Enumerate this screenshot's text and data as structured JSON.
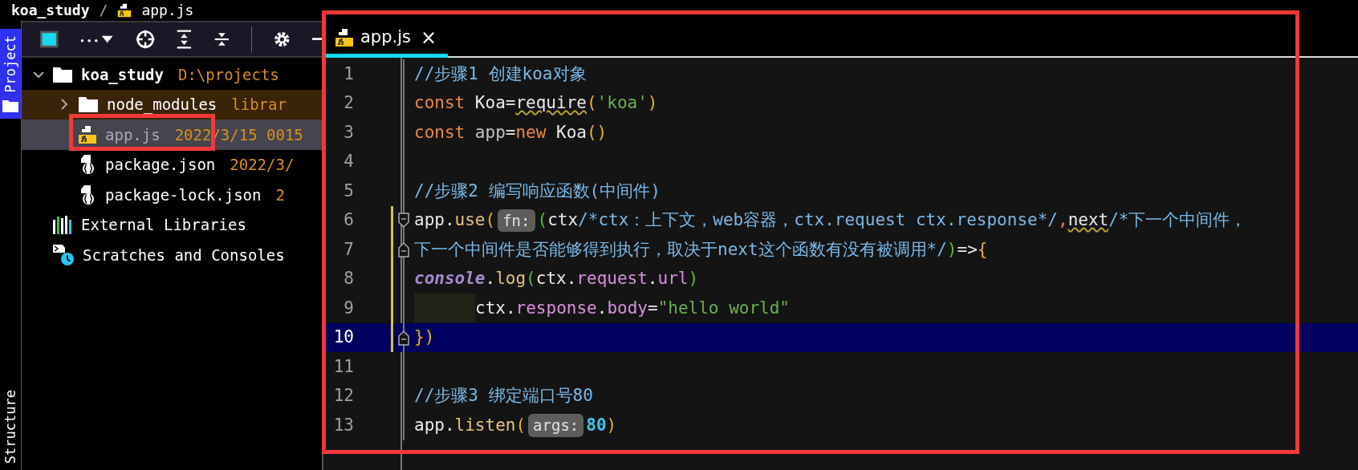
{
  "breadcrumb": [
    {
      "label": "koa_study",
      "kind": "folder"
    },
    {
      "label": "/",
      "kind": "separator"
    },
    {
      "label": "app.js",
      "kind": "js"
    }
  ],
  "side_tabs": [
    {
      "label": "Project",
      "selected": true
    },
    {
      "label": "Structure",
      "selected": false
    }
  ],
  "tree": [
    {
      "label": "koa_study",
      "detail": "D:\\projects",
      "kind": "folder",
      "bold": true,
      "expanded": true,
      "selected": false,
      "excluded": false,
      "children": [
        {
          "label": "node_modules",
          "detail": "librar",
          "kind": "folder",
          "bold": false,
          "expanded": false,
          "selected": false,
          "excluded": true
        },
        {
          "label": "app.js",
          "detail": "2022/3/15 0015",
          "kind": "js",
          "bold": false,
          "selected": true,
          "excluded": false
        },
        {
          "label": "package.json",
          "detail": "2022/3/",
          "kind": "json",
          "bold": false,
          "selected": false,
          "excluded": false
        },
        {
          "label": "package-lock.json",
          "detail": "2",
          "kind": "json",
          "bold": false,
          "selected": false,
          "excluded": false
        }
      ]
    },
    {
      "label": "External Libraries",
      "kind": "libraries",
      "bold": false,
      "selected": false,
      "excluded": false
    },
    {
      "label": "Scratches and Consoles",
      "kind": "scratches",
      "bold": false,
      "selected": false,
      "excluded": false
    }
  ],
  "tabs": [
    {
      "label": "app.js",
      "close": "×",
      "selected": true
    }
  ],
  "lines": [
    {
      "number": "1",
      "selected": false,
      "modified": false,
      "fold_open": false,
      "fold_close": false,
      "tokens": [
        {
          "kind": "comment",
          "text": "//步骤1 创建koa对象"
        }
      ]
    },
    {
      "number": "2",
      "selected": false,
      "modified": false,
      "fold_open": false,
      "fold_close": false,
      "tokens": [
        {
          "kind": "keyword",
          "text": "const"
        },
        {
          "kind": "plain",
          "text": " Koa="
        },
        {
          "kind": "warn",
          "text": "require"
        },
        {
          "kind": "paren",
          "text": "("
        },
        {
          "kind": "string",
          "text": "'koa'"
        },
        {
          "kind": "paren",
          "text": ")"
        }
      ]
    },
    {
      "number": "3",
      "selected": false,
      "modified": false,
      "fold_open": false,
      "fold_close": false,
      "tokens": [
        {
          "kind": "keyword",
          "text": "const"
        },
        {
          "kind": "dim",
          "text": " app"
        },
        {
          "kind": "plain",
          "text": "="
        },
        {
          "kind": "keyword",
          "text": "new"
        },
        {
          "kind": "plain",
          "text": " Koa"
        },
        {
          "kind": "paren",
          "text": "()"
        }
      ]
    },
    {
      "number": "4",
      "selected": false,
      "modified": false,
      "fold_open": false,
      "fold_close": false
    },
    {
      "number": "5",
      "selected": false,
      "modified": false,
      "fold_open": false,
      "fold_close": false,
      "tokens": [
        {
          "kind": "comment",
          "text": "//步骤2 编写响应函数(中间件)"
        }
      ]
    },
    {
      "number": "6",
      "selected": false,
      "modified": true,
      "fold_open": true,
      "fold_close": false,
      "tokens": [
        {
          "kind": "plain",
          "text": "app."
        },
        {
          "kind": "method",
          "text": "use"
        },
        {
          "kind": "paren",
          "text": "("
        },
        {
          "kind": "hint",
          "text": "fn:"
        },
        {
          "kind": "paren2",
          "text": "("
        },
        {
          "kind": "plain",
          "text": "ctx"
        },
        {
          "kind": "comment",
          "text": "/*ctx：上下文，web容器，ctx.request ctx.response*/"
        },
        {
          "kind": "punct",
          "text": ","
        },
        {
          "kind": "warn",
          "text": "next"
        },
        {
          "kind": "comment",
          "text": "/*下一个中间件，"
        }
      ]
    },
    {
      "number": "7",
      "selected": false,
      "modified": true,
      "fold_open": false,
      "fold_close": true,
      "tokens": [
        {
          "kind": "comment",
          "text": "下一个中间件是否能够得到执行，取决于next这个函数有没有被调用*/"
        },
        {
          "kind": "paren2",
          "text": ")"
        },
        {
          "kind": "plain",
          "text": "=>"
        },
        {
          "kind": "paren",
          "text": "{"
        }
      ]
    },
    {
      "number": "8",
      "selected": false,
      "modified": true,
      "fold_open": false,
      "fold_close": false,
      "tokens": [
        {
          "kind": "global",
          "text": "console"
        },
        {
          "kind": "plain",
          "text": "."
        },
        {
          "kind": "method",
          "text": "log"
        },
        {
          "kind": "paren2",
          "text": "("
        },
        {
          "kind": "plain",
          "text": "ctx."
        },
        {
          "kind": "field",
          "text": "request"
        },
        {
          "kind": "plain",
          "text": "."
        },
        {
          "kind": "field",
          "text": "url"
        },
        {
          "kind": "paren2",
          "text": ")"
        }
      ]
    },
    {
      "number": "9",
      "selected": false,
      "modified": true,
      "fold_open": false,
      "fold_close": false,
      "tokens": [
        {
          "kind": "indent"
        },
        {
          "kind": "plain",
          "text": "ctx."
        },
        {
          "kind": "field",
          "text": "response"
        },
        {
          "kind": "plain",
          "text": "."
        },
        {
          "kind": "field",
          "text": "body"
        },
        {
          "kind": "plain",
          "text": "="
        },
        {
          "kind": "string",
          "text": "\"hello world\""
        }
      ]
    },
    {
      "number": "10",
      "selected": true,
      "modified": true,
      "fold_open": false,
      "fold_close": true,
      "tokens": [
        {
          "kind": "paren",
          "text": "})"
        }
      ]
    },
    {
      "number": "11",
      "selected": false,
      "modified": false,
      "fold_open": false,
      "fold_close": false
    },
    {
      "number": "12",
      "selected": false,
      "modified": false,
      "fold_open": false,
      "fold_close": false,
      "tokens": [
        {
          "kind": "comment",
          "text": "//步骤3 绑定端口号80"
        }
      ]
    },
    {
      "number": "13",
      "selected": false,
      "modified": false,
      "fold_open": false,
      "fold_close": false,
      "tokens": [
        {
          "kind": "plain",
          "text": "app."
        },
        {
          "kind": "method",
          "text": "listen"
        },
        {
          "kind": "paren",
          "text": "("
        },
        {
          "kind": "hint",
          "text": "args:"
        },
        {
          "kind": "number",
          "text": "80"
        },
        {
          "kind": "paren",
          "text": ")"
        }
      ]
    }
  ]
}
